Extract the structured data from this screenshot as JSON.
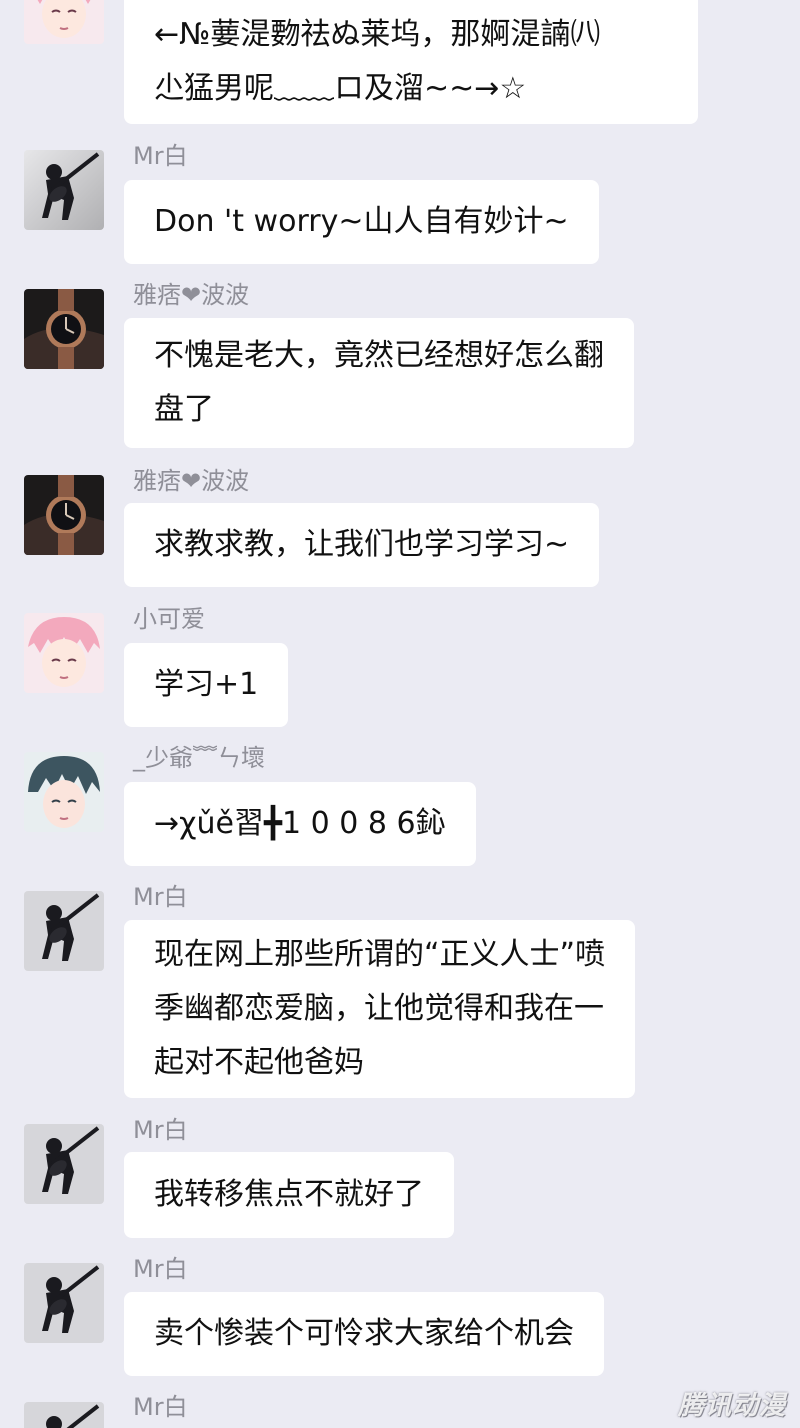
{
  "messages": [
    {
      "sender": "",
      "avatar": "pink-haired-boy-avatar",
      "text": "←№葽湜覅祛ぬ莱坞，那婀湜諵㈧\n尐猛男呢﹏﹏ロ及溜~~→☆"
    },
    {
      "sender": "Mr白",
      "avatar": "guitarist-avatar",
      "text": "Don 't worry~山人自有妙计~"
    },
    {
      "sender": "雅痞❤波波",
      "avatar": "wristwatch-avatar",
      "text": "不愧是老大，竟然已经想好怎么翻\n盘了"
    },
    {
      "sender": "雅痞❤波波",
      "avatar": "wristwatch-avatar",
      "text": "求教求教，让我们也学习学习~"
    },
    {
      "sender": "小可爱",
      "avatar": "pink-haired-boy-avatar",
      "text": "学习+1"
    },
    {
      "sender": "_少爺﹌ㄣ壞",
      "avatar": "dark-haired-boy-avatar",
      "text": "→χǔě習╋1 0 0 8 6鈊"
    },
    {
      "sender": "Mr白",
      "avatar": "guitarist-avatar",
      "text": "现在网上那些所谓的“正义人士”喷\n季幽都恋爱脑，让他觉得和我在一\n起对不起他爸妈"
    },
    {
      "sender": "Mr白",
      "avatar": "guitarist-avatar",
      "text": "我转移焦点不就好了"
    },
    {
      "sender": "Mr白",
      "avatar": "guitarist-avatar",
      "text": "卖个惨装个可怜求大家给个机会"
    },
    {
      "sender": "Mr白",
      "avatar": "guitarist-avatar",
      "text": ""
    }
  ],
  "watermark": "腾讯动漫",
  "colors": {
    "background": "#ebebf3",
    "bubble": "#ffffff",
    "sender": "#8f8f98",
    "text": "#111111"
  }
}
